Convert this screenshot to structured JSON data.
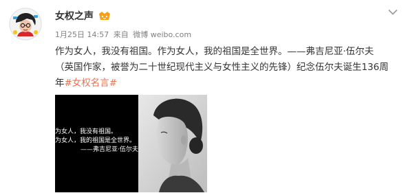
{
  "post": {
    "username": "女权之声",
    "date": "1月25日 14:57",
    "source_prefix": "来自",
    "source_name": "微博 weibo.com",
    "content_line1": "作为女人，我没有祖国。作为女人，我的祖国是全世界。——弗吉尼亚·伍尔夫",
    "content_line2": "（英国作家，被誉为二十世纪现代主义与女性主义的先锋）纪念伍尔夫诞生136周",
    "content_line3_prefix": "年",
    "hashtag": "#女权名言#"
  },
  "image": {
    "quote_line1": "为女人，我没有祖国。",
    "quote_line2": "为女人，我的祖国是全世界。",
    "quote_signature": "——弗吉尼亚·伍尔夫"
  },
  "icons": {
    "avatar": "avatar-cartoon-icon",
    "badge": "vip-badge-icon",
    "menu": "chevron-down-icon"
  },
  "colors": {
    "hashtag": "#eb7350",
    "meta": "#808080",
    "text": "#333333",
    "badge": "#f7a11a"
  }
}
